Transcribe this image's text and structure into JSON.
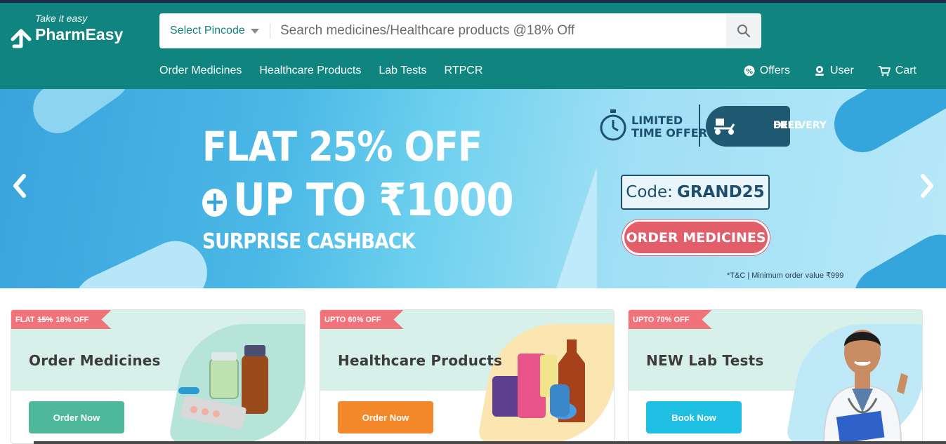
{
  "brand": {
    "tagline": "Take it easy",
    "name": "PharmEasy"
  },
  "search": {
    "pincode_label": "Select Pincode",
    "placeholder": "Search medicines/Healthcare products @18% Off"
  },
  "nav": {
    "main": [
      "Order Medicines",
      "Healthcare Products",
      "Lab Tests",
      "RTPCR"
    ],
    "offers": "Offers",
    "user": "User",
    "cart": "Cart"
  },
  "banner": {
    "line1": "FLAT 25% OFF",
    "line2": "UP TO ₹1000",
    "line3": "SURPRISE CASHBACK",
    "limited_offer": [
      "LIMITED",
      "TIME OFFER"
    ],
    "free_delivery": [
      "FREE",
      "DELIVERY"
    ],
    "code_label": "Code:",
    "code_value": "GRAND25",
    "cta": "ORDER MEDICINES",
    "tnc": "*T&C | Minimum order value ₹999"
  },
  "cards": [
    {
      "ribbon_prefix": "FLAT",
      "ribbon_struck": "15%",
      "ribbon_suffix": "18% OFF",
      "title": "Order Medicines",
      "button": "Order Now",
      "button_color": "#4fb89a",
      "bg": "#d7f1ea",
      "blob": "#b6e4d8"
    },
    {
      "ribbon_prefix": "UPTO 60% OFF",
      "title": "Healthcare Products",
      "button": "Order Now",
      "button_color": "#f4892c",
      "bg": "#d7f1ea",
      "blob": "#fbe6b2"
    },
    {
      "ribbon_prefix": "UPTO 70% OFF",
      "title": "NEW Lab Tests",
      "button": "Book Now",
      "button_color": "#1ebfe3",
      "bg": "#d7f1ea",
      "blob": "#bfe9f6"
    }
  ],
  "colors": {
    "brand": "#10847e",
    "ribbon": "#f0727a"
  }
}
